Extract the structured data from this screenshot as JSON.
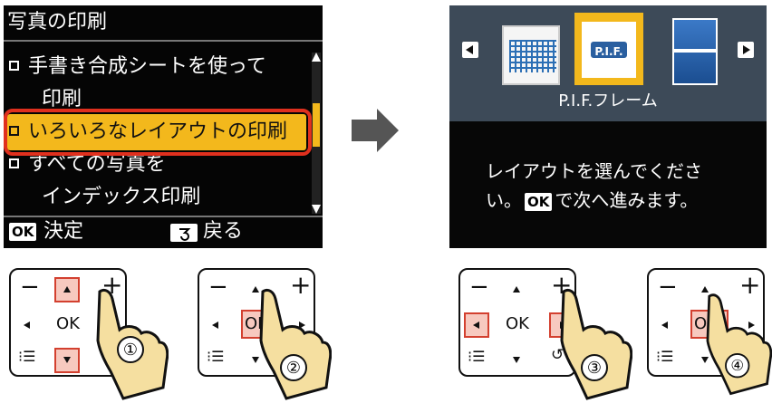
{
  "screen1": {
    "title": "写真の印刷",
    "menu": [
      {
        "line1": "手書き合成シートを使って",
        "line2": "印刷"
      },
      {
        "line1": "いろいろなレイアウトの印刷"
      },
      {
        "line1": "すべての写真を",
        "line2": "インデックス印刷"
      }
    ],
    "footer": {
      "ok_key": "OK",
      "ok_label": "決定",
      "back_label": "戻る"
    }
  },
  "screen2": {
    "pif_badge": "P.I.F.",
    "caption": "P.I.F.フレーム",
    "desc_line1": "レイアウトを選んでくださ",
    "desc_line2_a": "い。",
    "ok_key": "OK",
    "desc_line2_b": "で次へ進みます。"
  },
  "panel": {
    "minus": "−",
    "plus": "+",
    "ok": "OK",
    "menu_icon": "⁝☰",
    "back_icon": "↺"
  },
  "steps": [
    "①",
    "②",
    "③",
    "④"
  ],
  "colors": {
    "highlight": "#f3b81c",
    "ring": "#e0301e",
    "key_highlight": "#f7c9bf"
  }
}
